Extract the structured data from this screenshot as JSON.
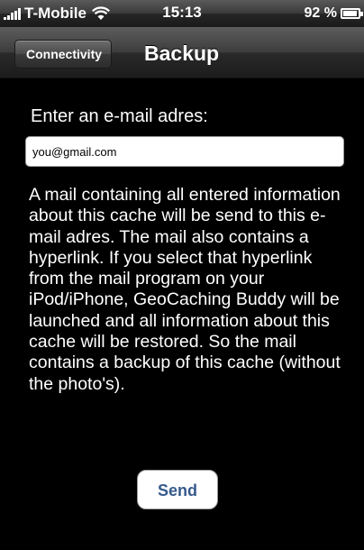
{
  "status_bar": {
    "carrier": "T-Mobile",
    "time": "15:13",
    "battery_percent": "92 %",
    "battery_level": 0.92,
    "icons": [
      "signal-bars-icon",
      "wifi-icon",
      "battery-icon"
    ]
  },
  "nav_bar": {
    "back_label": "Connectivity",
    "title": "Backup"
  },
  "form": {
    "prompt": "Enter an e-mail adres:",
    "email_value": "you@gmail.com",
    "description": "A mail containing all entered information about this cache will be send to this e-mail adres. The mail also contains a hyperlink. If you select that hyperlink from the mail program on your iPod/iPhone, GeoCaching Buddy will be launched and all information about this cache will be restored. So the mail contains a backup of this cache (without the photo's).",
    "send_label": "Send"
  },
  "colors": {
    "background": "#000000",
    "text": "#ffffff",
    "button_text": "#375a8c"
  }
}
